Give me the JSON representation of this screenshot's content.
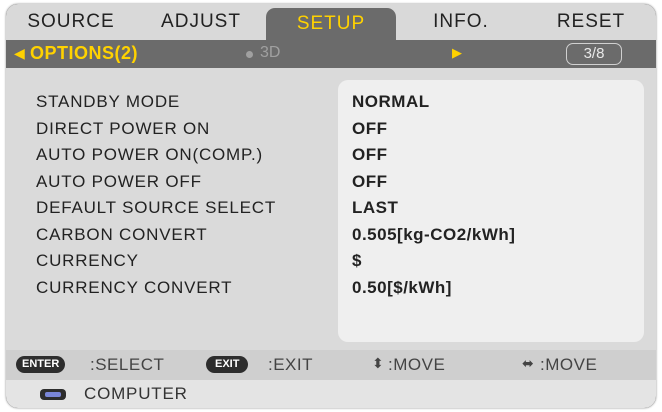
{
  "tabs": [
    {
      "label": "SOURCE"
    },
    {
      "label": "ADJUST"
    },
    {
      "label": "SETUP"
    },
    {
      "label": "INFO."
    },
    {
      "label": "RESET"
    }
  ],
  "active_tab": "SETUP",
  "subbar": {
    "title": "OPTIONS(2)",
    "next_label": "3D",
    "page_indicator": "3/8"
  },
  "settings": [
    {
      "label": "STANDBY MODE",
      "value": "NORMAL"
    },
    {
      "label": "DIRECT POWER ON",
      "value": "OFF"
    },
    {
      "label": "AUTO POWER ON(COMP.)",
      "value": "OFF"
    },
    {
      "label": "AUTO POWER OFF",
      "value": "OFF"
    },
    {
      "label": "DEFAULT SOURCE SELECT",
      "value": "LAST"
    },
    {
      "label": "CARBON CONVERT",
      "value": "0.505[kg-CO2/kWh]"
    },
    {
      "label": "CURRENCY",
      "value": "$"
    },
    {
      "label": "CURRENCY CONVERT",
      "value": "0.50[$/kWh]"
    }
  ],
  "footer": {
    "enter_key": "ENTER",
    "select_label": ":SELECT",
    "exit_key": "EXIT",
    "exit_label": ":EXIT",
    "move_vertical_label": ":MOVE",
    "move_horizontal_label": ":MOVE"
  },
  "source": {
    "label": "COMPUTER"
  },
  "colors": {
    "accent": "#ffd200",
    "active_tab_bg": "#6b6b6b",
    "tab_bar_bg": "#d9d9d9",
    "panel_bg": "#dadada"
  },
  "icons": {
    "left_arrow": "triangle-left-icon",
    "right_arrow": "triangle-right-icon",
    "vertical_move": "up-down-arrows-icon",
    "horizontal_move": "left-right-arrows-icon",
    "source": "computer-input-icon"
  }
}
